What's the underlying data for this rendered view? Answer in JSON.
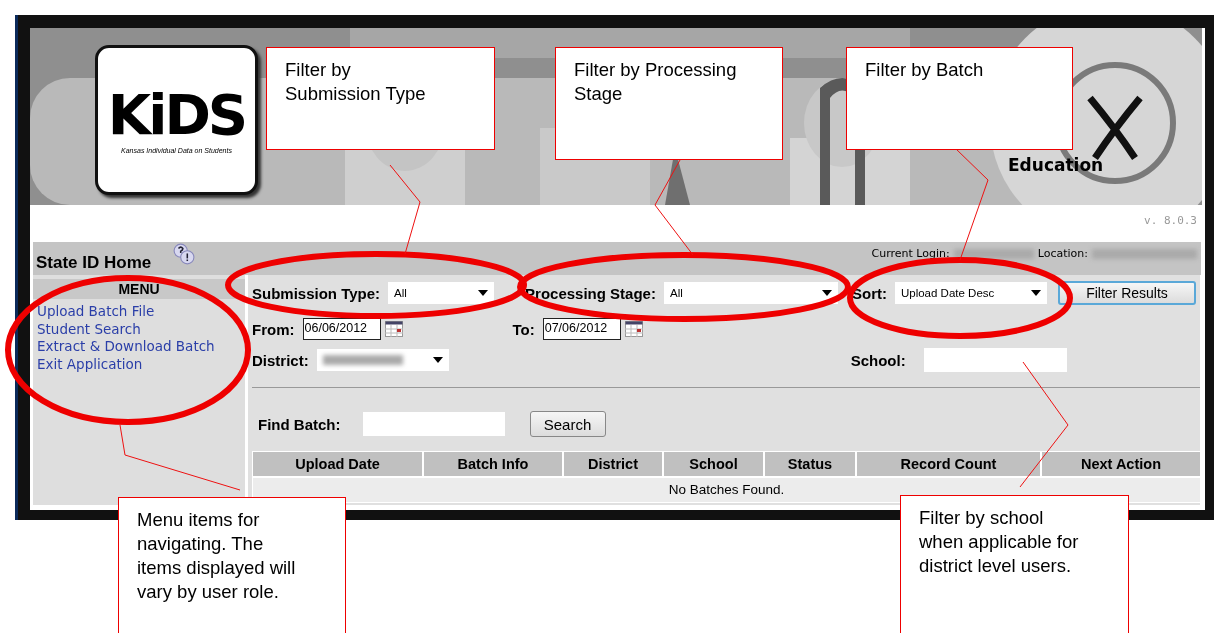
{
  "banner": {
    "logo_title": "KiDS",
    "logo_subtitle": "Kansas Individual Data on Students",
    "agency_word": "Education",
    "version": "v. 8.0.3"
  },
  "title_bar": {
    "title": "State ID Home",
    "login_label": "Current Login:",
    "location_label": "Location:"
  },
  "menu": {
    "heading": "MENU",
    "items": [
      "Upload Batch File",
      "Student Search",
      "Extract & Download Batch",
      "Exit Application"
    ]
  },
  "filters": {
    "submission_type": {
      "label": "Submission Type:",
      "value": "All"
    },
    "processing_stage": {
      "label": "Processing Stage:",
      "value": "All"
    },
    "sort": {
      "label": "Sort:",
      "value": "Upload Date Desc"
    },
    "filter_button": "Filter Results",
    "from": {
      "label": "From:",
      "value": "06/06/2012"
    },
    "to": {
      "label": "To:",
      "value": "07/06/2012"
    },
    "district": {
      "label": "District:"
    },
    "school": {
      "label": "School:"
    }
  },
  "find_batch": {
    "label": "Find Batch:",
    "button": "Search"
  },
  "table": {
    "columns": [
      "Upload Date",
      "Batch Info",
      "District",
      "School",
      "Status",
      "Record Count",
      "Next Action"
    ],
    "empty_message": "No Batches Found."
  },
  "callouts": [
    {
      "lines": [
        "Filter by",
        "Submission Type"
      ]
    },
    {
      "lines": [
        "Filter by Processing",
        "Stage"
      ]
    },
    {
      "lines": [
        "Filter by Batch"
      ]
    },
    {
      "lines": [
        "Menu items for",
        "navigating. The",
        "items displayed will",
        "vary by user role."
      ]
    },
    {
      "lines": [
        "Filter by school",
        "when applicable for",
        "district level users."
      ]
    }
  ]
}
